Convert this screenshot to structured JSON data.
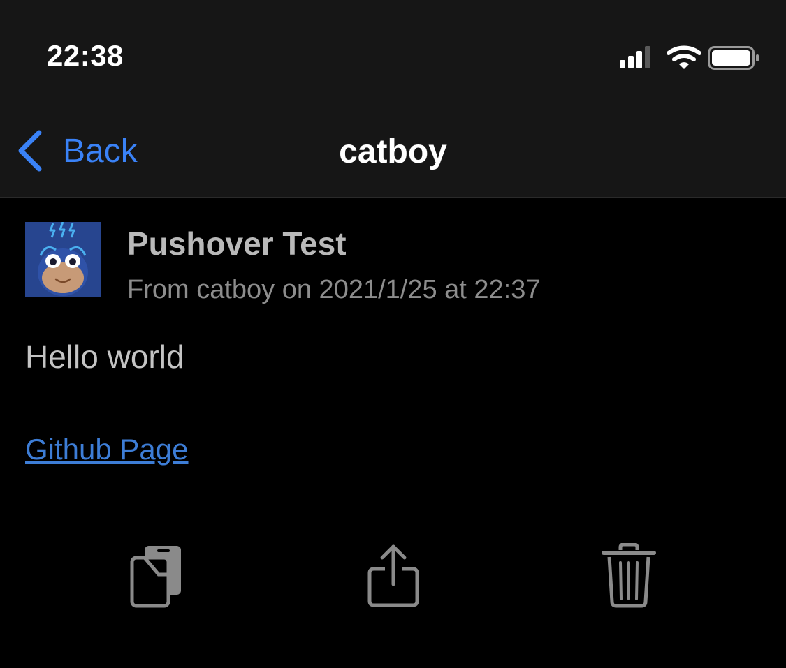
{
  "status_bar": {
    "time": "22:38",
    "icons": [
      "cellular-signal-icon",
      "wifi-icon",
      "battery-icon"
    ]
  },
  "nav": {
    "back_label": "Back",
    "title": "catboy"
  },
  "message": {
    "avatar": "catboy-avatar",
    "title": "Pushover Test",
    "meta": "From catboy on 2021/1/25 at 22:37",
    "body": "Hello world",
    "link_text": "Github Page"
  },
  "toolbar": {
    "actions": [
      "copy-icon",
      "share-icon",
      "trash-icon"
    ]
  },
  "colors": {
    "accent": "#3a82f7",
    "link": "#3d7dd6",
    "background": "#000000",
    "bar_background": "#161616",
    "icon_gray": "#8a8a8a"
  }
}
